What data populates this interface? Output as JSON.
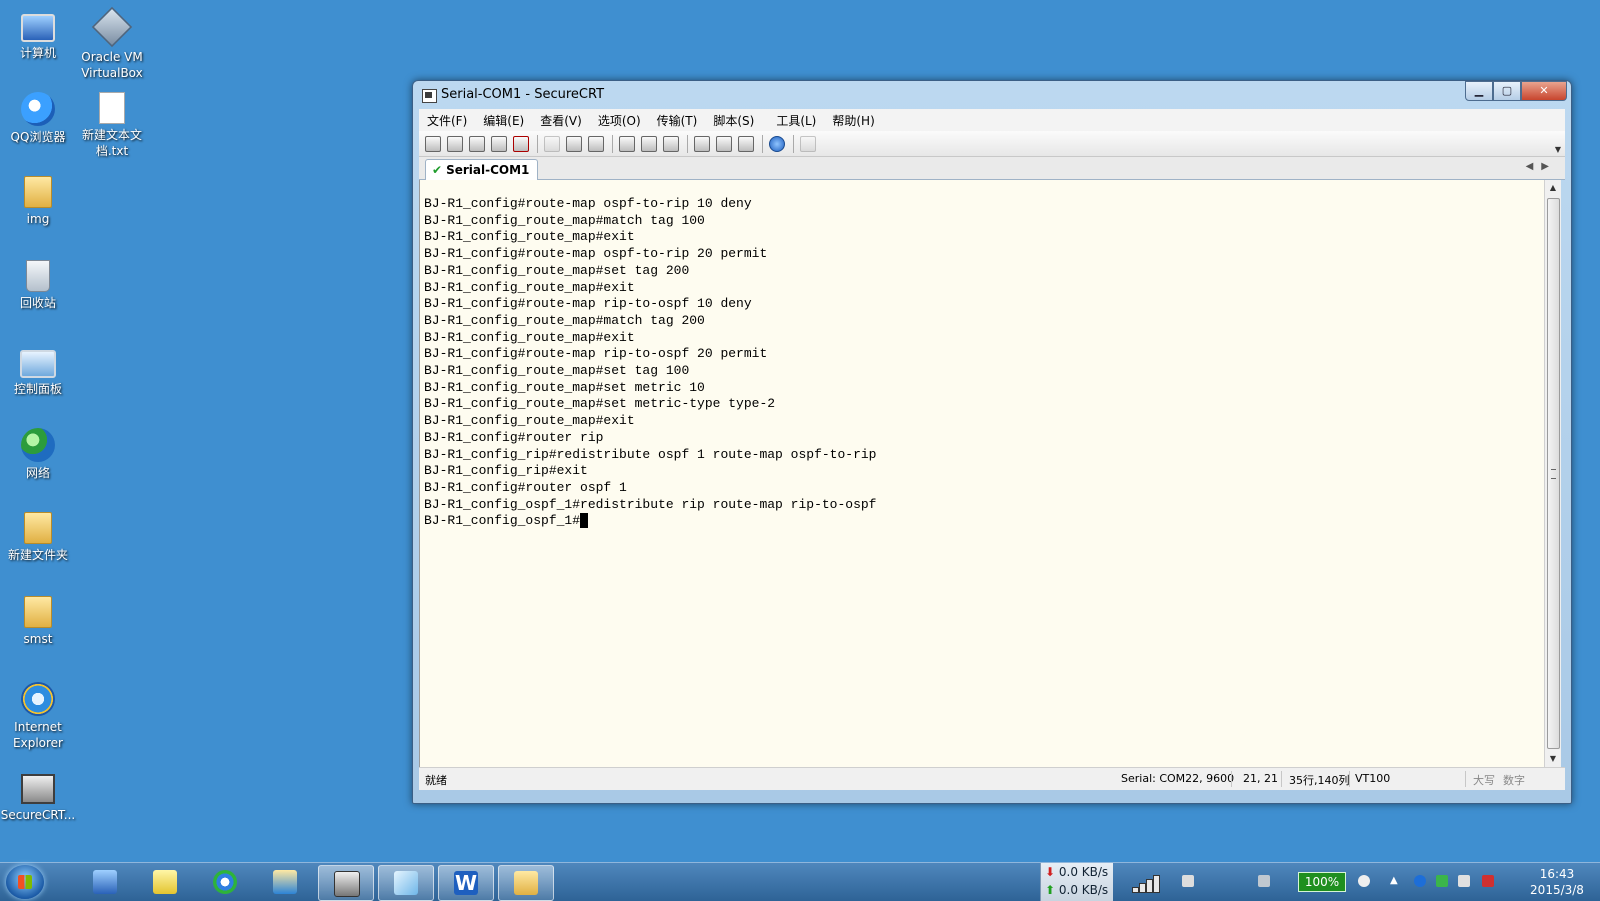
{
  "desktop_icons": [
    {
      "label": "计算机",
      "icon": "computer-icon"
    },
    {
      "label": "Oracle VM VirtualBox",
      "icon": "virtualbox-icon"
    },
    {
      "label": "QQ浏览器",
      "icon": "qq-browser-icon"
    },
    {
      "label": "新建文本文档.txt",
      "icon": "text-file-icon"
    },
    {
      "label": "img",
      "icon": "folder-icon"
    },
    {
      "label": "回收站",
      "icon": "recycle-bin-icon"
    },
    {
      "label": "控制面板",
      "icon": "control-panel-icon"
    },
    {
      "label": "网络",
      "icon": "network-icon"
    },
    {
      "label": "新建文件夹",
      "icon": "folder-icon"
    },
    {
      "label": "smst",
      "icon": "folder-icon"
    },
    {
      "label": "Internet Explorer",
      "icon": "ie-icon"
    },
    {
      "label": "SecureCRT...",
      "icon": "securecrt-icon"
    }
  ],
  "window": {
    "title": "Serial-COM1 - SecureCRT",
    "menu": [
      "文件(F)",
      "编辑(E)",
      "查看(V)",
      "选项(O)",
      "传输(T)",
      "脚本(S)",
      "工具(L)",
      "帮助(H)"
    ],
    "tab_label": "Serial-COM1",
    "terminal_lines": [
      "BJ-R1_config#route-map ospf-to-rip 10 deny",
      "BJ-R1_config_route_map#match tag 100",
      "BJ-R1_config_route_map#exit",
      "BJ-R1_config#route-map ospf-to-rip 20 permit",
      "BJ-R1_config_route_map#set tag 200",
      "BJ-R1_config_route_map#exit",
      "BJ-R1_config#route-map rip-to-ospf 10 deny",
      "BJ-R1_config_route_map#match tag 200",
      "BJ-R1_config_route_map#exit",
      "BJ-R1_config#route-map rip-to-ospf 20 permit",
      "BJ-R1_config_route_map#set tag 100",
      "BJ-R1_config_route_map#set metric 10",
      "BJ-R1_config_route_map#set metric-type type-2",
      "BJ-R1_config_route_map#exit",
      "BJ-R1_config#router rip",
      "BJ-R1_config_rip#redistribute ospf 1 route-map ospf-to-rip",
      "BJ-R1_config_rip#exit",
      "BJ-R1_config#router ospf 1",
      "BJ-R1_config_ospf_1#redistribute rip route-map rip-to-ospf",
      "BJ-R1_config_ospf_1#"
    ],
    "status": {
      "ready": "就绪",
      "connection": "Serial: COM22, 9600",
      "cursor_pos": "21, 21",
      "size": "35行,140列",
      "terminal_type": "VT100",
      "caps": "大写",
      "num": "数字"
    }
  },
  "taskbar": {
    "net_down": "0.0 KB/s",
    "net_up": "0.0 KB/s",
    "battery": "100%",
    "time": "16:43",
    "date": "2015/3/8"
  }
}
